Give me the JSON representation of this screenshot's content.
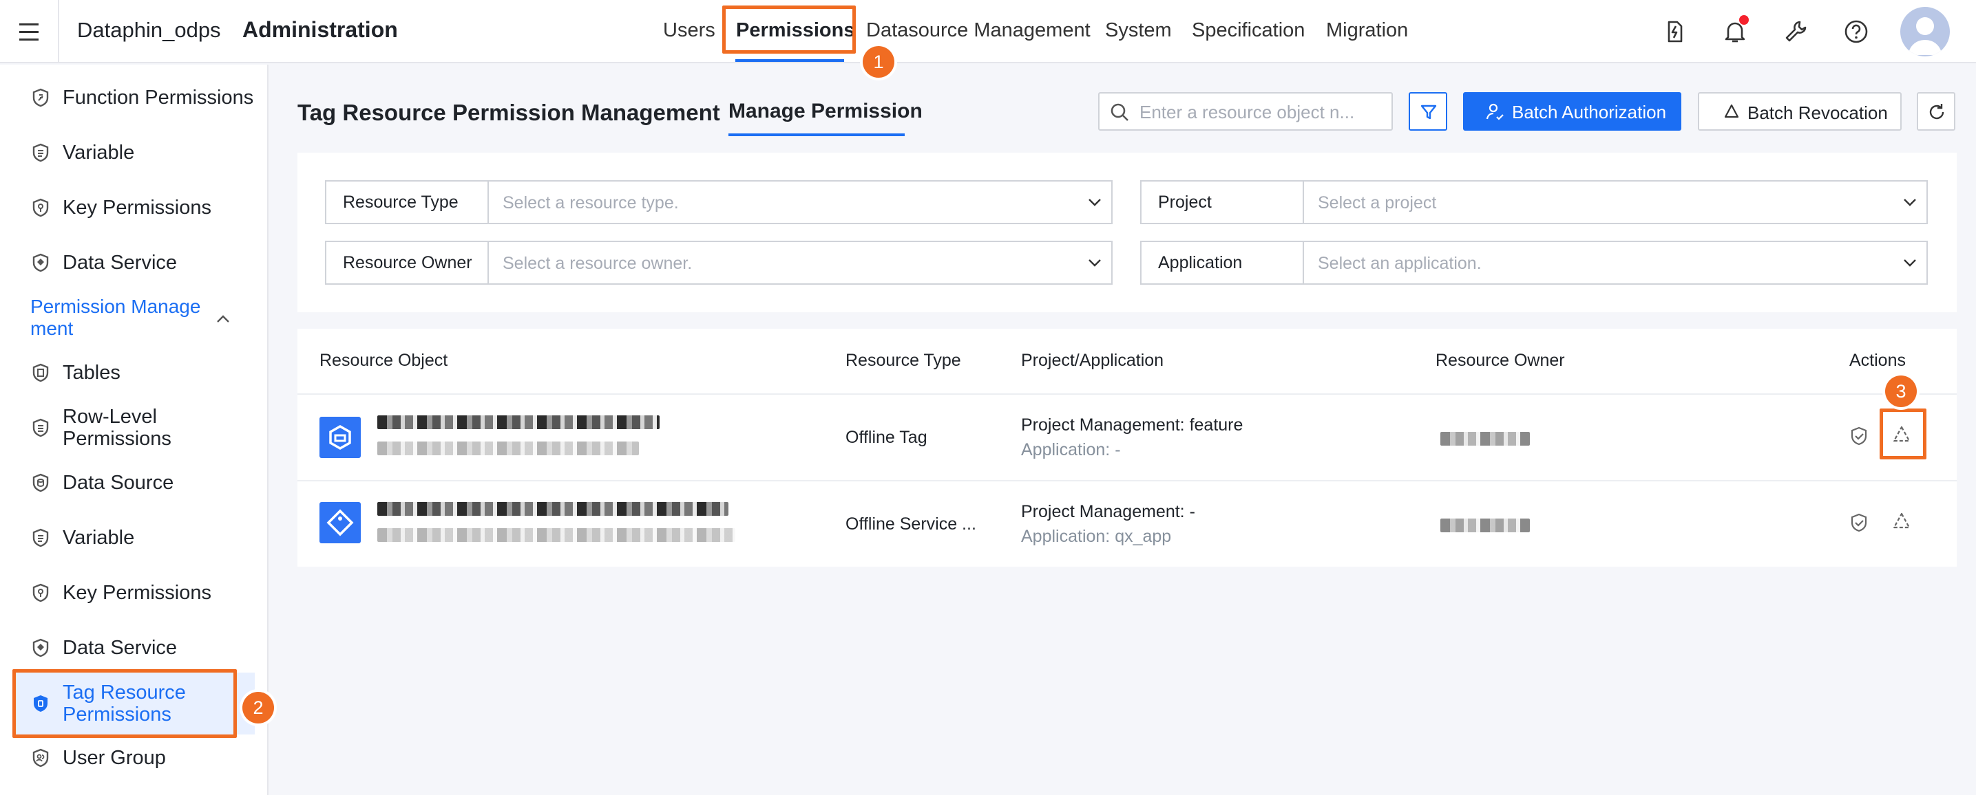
{
  "header": {
    "app_name": "Dataphin_odps",
    "section_title": "Administration",
    "nav": [
      "Users",
      "Permissions",
      "Datasource Management",
      "System",
      "Specification",
      "Migration"
    ],
    "active_nav": "Permissions",
    "icons": [
      "tasks-icon",
      "bell-icon",
      "wrench-icon",
      "help-icon",
      "avatar"
    ]
  },
  "annotations": [
    "1",
    "2",
    "3"
  ],
  "sidebar": {
    "items_top": [
      "Function Permissions",
      "Variable",
      "Key Permissions",
      "Data Service"
    ],
    "group_label": "Permission Manage ment",
    "group_items": [
      "Tables",
      "Row-Level Permissions",
      "Data Source",
      "Variable",
      "Key Permissions",
      "Data Service",
      "Tag Resource Permissions",
      "User Group"
    ],
    "selected": "Tag Resource Permissions"
  },
  "main": {
    "title": "Tag Resource Permission Management",
    "tab": "Manage Permission",
    "search_placeholder": "Enter a resource object n...",
    "batch_authorization": "Batch Authorization",
    "batch_revocation": "Batch Revocation",
    "filters": {
      "resource_type": {
        "label": "Resource Type",
        "placeholder": "Select a resource type."
      },
      "project": {
        "label": "Project",
        "placeholder": "Select a project"
      },
      "resource_owner": {
        "label": "Resource Owner",
        "placeholder": "Select a resource owner."
      },
      "application": {
        "label": "Application",
        "placeholder": "Select an application."
      }
    },
    "table": {
      "columns": [
        "Resource Object",
        "Resource Type",
        "Project/Application",
        "Resource Owner",
        "Actions"
      ],
      "rows": [
        {
          "resource_type": "Offline Tag",
          "project": "Project Management: feature",
          "application": "Application: -"
        },
        {
          "resource_type": "Offline Service ...",
          "project": "Project Management: -",
          "application": "Application: qx_app"
        }
      ]
    }
  },
  "colors": {
    "accent": "#1b6ef3",
    "highlight": "#f06c22",
    "notification": "#f5222d"
  }
}
